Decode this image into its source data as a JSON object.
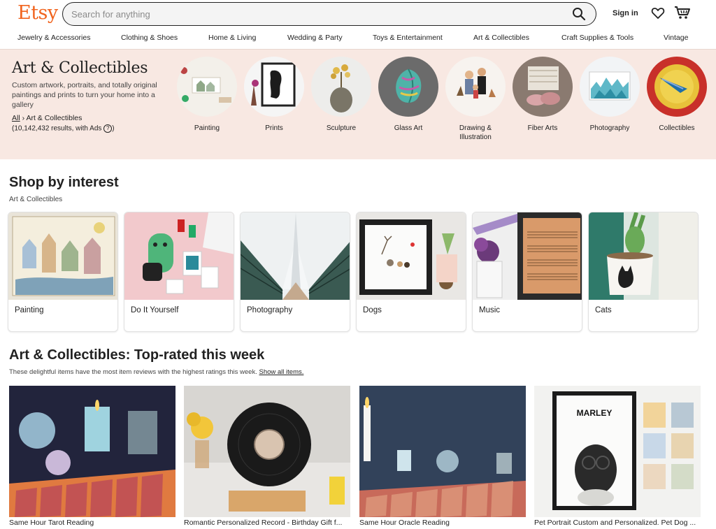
{
  "header": {
    "logo": "Etsy",
    "search_placeholder": "Search for anything",
    "signin": "Sign in"
  },
  "nav": [
    "Jewelry & Accessories",
    "Clothing & Shoes",
    "Home & Living",
    "Wedding & Party",
    "Toys & Entertainment",
    "Art & Collectibles",
    "Craft Supplies & Tools",
    "Vintage"
  ],
  "hero": {
    "title": "Art & Collectibles",
    "description": "Custom artwork, portraits, and totally original paintings and prints to turn your home into a gallery",
    "crumb_all": "All",
    "crumb_sep": "›",
    "crumb_current": "Art & Collectibles",
    "results": "(10,142,432 results, with Ads",
    "results_close": ")",
    "qmark": "?",
    "categories": [
      "Painting",
      "Prints",
      "Sculpture",
      "Glass Art",
      "Drawing & Illustration",
      "Fiber Arts",
      "Photography",
      "Collectibles"
    ]
  },
  "interest": {
    "title": "Shop by interest",
    "subtitle": "Art & Collectibles",
    "cards": [
      "Painting",
      "Do It Yourself",
      "Photography",
      "Dogs",
      "Music",
      "Cats"
    ]
  },
  "top_rated": {
    "title": "Art & Collectibles: Top-rated this week",
    "subtitle": "These delightful items have the most item reviews with the highest ratings this week.",
    "show_all": "Show all items.",
    "products": [
      "Same Hour Tarot Reading",
      "Romantic Personalized Record - Birthday Gift f...",
      "Same Hour Oracle Reading",
      "Pet Portrait Custom and Personalized. Pet Dog ..."
    ],
    "marley": "MARLEY"
  },
  "colors": {
    "brand": "#f1641e",
    "hero_bg": "#f8e8e2"
  },
  "icons": [
    "search-icon",
    "heart-icon",
    "cart-icon"
  ]
}
